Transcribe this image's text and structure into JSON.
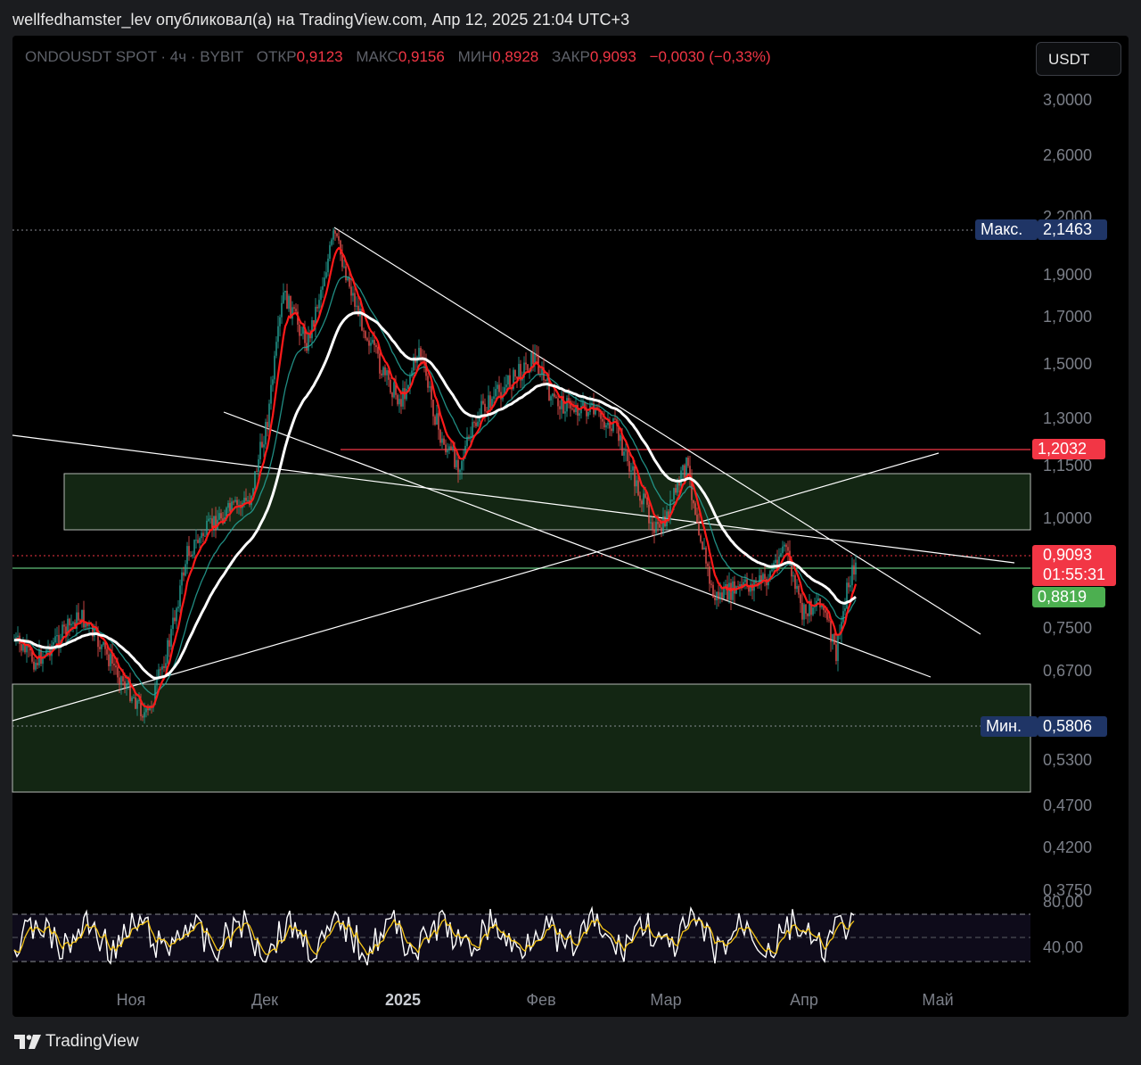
{
  "attribution": "wellfedhamster_lev опубликовал(а) на TradingView.com, Апр 12, 2025 21:04 UTC+3",
  "legend": {
    "symbol": "ONDOUSDT SPOT · 4ч · BYBIT",
    "open_label": "ОТКР",
    "open": "0,9123",
    "high_label": "МАКС",
    "high": "0,9156",
    "low_label": "МИН",
    "low": "0,8928",
    "close_label": "ЗАКР",
    "close": "0,9093",
    "change": "−0,0030 (−0,33%)"
  },
  "currency_button": "USDT",
  "price_axis": {
    "ticks": [
      "3,0000",
      "2,6000",
      "2,2000",
      "1,9000",
      "1,7000",
      "1,5000",
      "1,3000",
      "1,1500",
      "1,0000",
      "0,7500",
      "0,6700",
      "0,5300",
      "0,4700",
      "0,4200",
      "0,3750"
    ],
    "max_label": "Макс.",
    "max_value": "2,1463",
    "min_label": "Мин.",
    "min_value": "0,5806",
    "resistance_value": "1,2032",
    "last_price": "0,9093",
    "countdown": "01:55:31",
    "support_value": "0,8819"
  },
  "rsi_axis": {
    "ticks": [
      "80,00",
      "40,00"
    ]
  },
  "time_axis": {
    "ticks": [
      "Ноя",
      "Дек",
      "2025",
      "Фев",
      "Мар",
      "Апр",
      "Май"
    ]
  },
  "colors": {
    "background": "#000000",
    "candle_up": "#26a69a",
    "candle_down": "#ef5350",
    "ema_fast": "#ff1a1a",
    "ma_slow": "#ffffff",
    "zone_fill": "#132613",
    "label_navy": "#1f3566",
    "label_red": "#f23645",
    "label_green": "#4caf50",
    "rsi_line": "#ffffff",
    "rsi_signal": "#f5c518"
  },
  "footer": {
    "brand": "TradingView"
  }
}
